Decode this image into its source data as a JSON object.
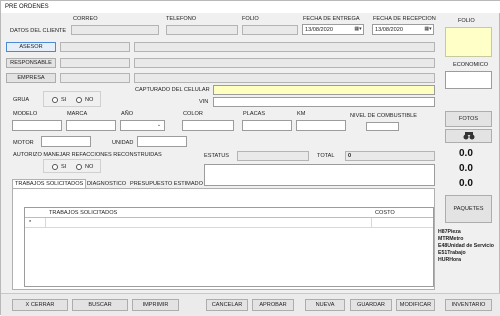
{
  "window": {
    "title": "PRE ORDENES"
  },
  "header": {
    "datos_cliente": "DATOS DEL CLIENTE",
    "correo": "CORREO",
    "telefono": "TELEFONO",
    "folio": "FOLIO",
    "fecha_entrega": "FECHA DE ENTREGA",
    "fecha_entrega_value": "13/08/2020",
    "fecha_recepcion": "FECHA DE RECEPCION",
    "fecha_recepcion_value": "13/08/2020"
  },
  "side": {
    "folio": "FOLIO",
    "economico": "ECONOMICO",
    "fotos": "FOTOS",
    "binoculars_icon": "binoculars-icon",
    "val1": "0.0",
    "val2": "0.0",
    "val3": "0.0",
    "paquetes": "PAQUETES",
    "legend": [
      "H87Pieza",
      "MTRMetro",
      "E48Unidad de Servicio",
      "E51Trabajo",
      "HURHora"
    ]
  },
  "form": {
    "asesor": "ASESOR",
    "responsable": "RESPONSABLE",
    "empresa": "EMPRESA",
    "capturado_celular": "CAPTURADO DEL CELULAR",
    "grua": "GRUA",
    "si": "SI",
    "no": "NO",
    "vin": "VIN",
    "modelo": "MODELO",
    "marca": "MARCA",
    "anio": "AÑO",
    "color": "COLOR",
    "placas": "PLACAS",
    "km": "KM",
    "nivel_combustible": "NIVEL DE COMBUSTIBLE",
    "motor": "MOTOR",
    "unidad": "UNIDAD",
    "autorizo": "AUTORIZO MANEJAR REFACCIONES RECONSTRUIDAS",
    "estatus": "ESTATUS",
    "total": "TOTAL",
    "total_value": "0"
  },
  "tabs": [
    "TRABAJOS SOLICITADOS",
    "DIAGNOSTICO",
    "PRESUPUESTO ESTIMADO"
  ],
  "grid": {
    "columns": [
      "TRABAJOS SOLICITADOS",
      "COSTO"
    ],
    "new_row_marker": "*"
  },
  "footer": {
    "cerrar": "X CERRAR",
    "buscar": "BUSCAR",
    "imprimir": "IMPRIMIR",
    "cancelar": "CANCELAR",
    "aprobar": "APROBAR",
    "nueva": "NUEVA",
    "guardar": "GUARDAR",
    "modificar": "MODIFICAR",
    "inventario": "INVENTARIO"
  },
  "colors": {
    "folio_bg": "#ffffc8",
    "capturado_bg": "#ffffc0",
    "accent": "#4a8bd4"
  }
}
